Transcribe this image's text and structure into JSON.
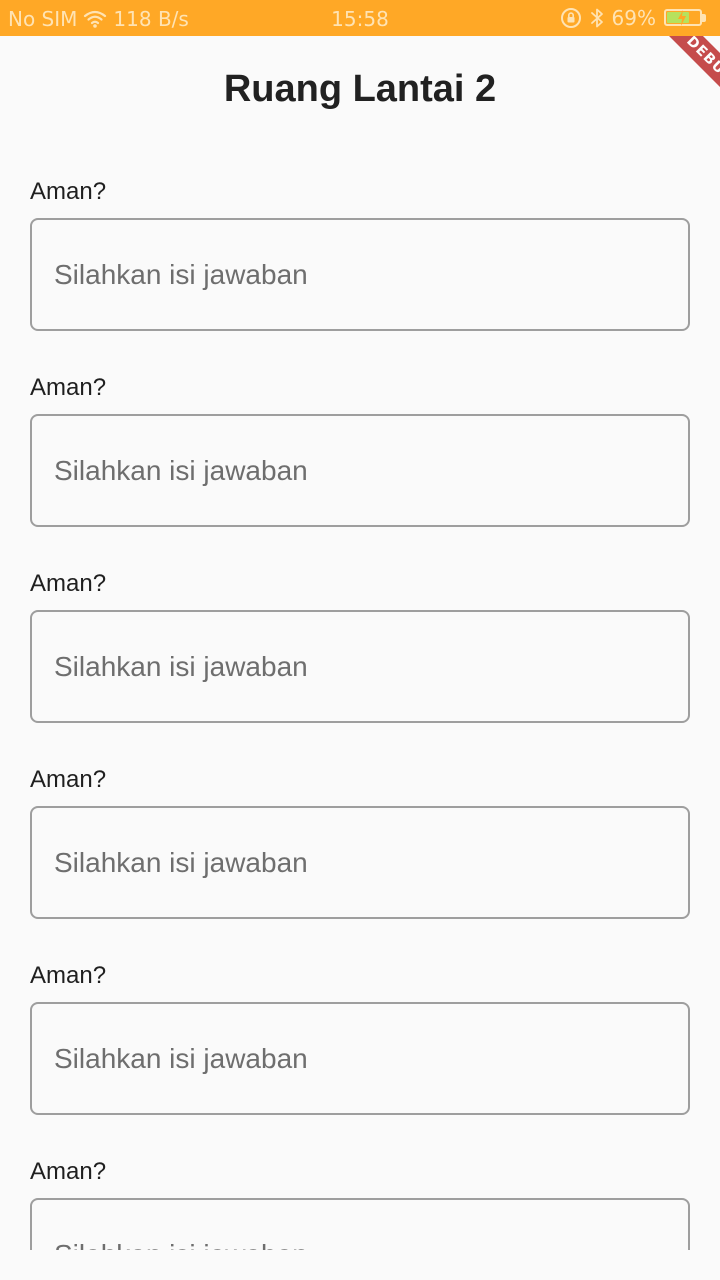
{
  "status_bar": {
    "carrier": "No SIM",
    "speed": "118 B/s",
    "time": "15:58",
    "battery": "69%",
    "battery_level": 0.69,
    "background_color": "#ffa826",
    "icons": [
      "wifi-icon",
      "rotation-lock-icon",
      "bluetooth-icon",
      "battery-icon"
    ]
  },
  "debug_banner": "DEBUG",
  "header": {
    "title": "Ruang Lantai 2"
  },
  "questions": [
    {
      "label": "Aman?",
      "placeholder": "Silahkan isi jawaban",
      "value": ""
    },
    {
      "label": "Aman?",
      "placeholder": "Silahkan isi jawaban",
      "value": ""
    },
    {
      "label": "Aman?",
      "placeholder": "Silahkan isi jawaban",
      "value": ""
    },
    {
      "label": "Aman?",
      "placeholder": "Silahkan isi jawaban",
      "value": ""
    },
    {
      "label": "Aman?",
      "placeholder": "Silahkan isi jawaban",
      "value": ""
    },
    {
      "label": "Aman?",
      "placeholder": "Silahkan isi jawaban",
      "value": ""
    }
  ]
}
